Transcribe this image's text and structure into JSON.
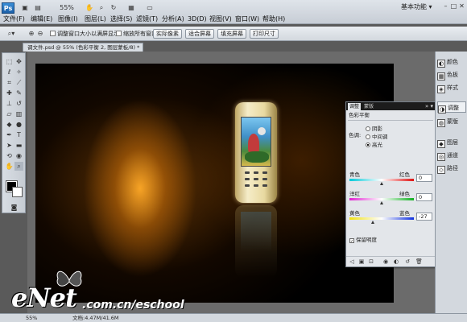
{
  "app": {
    "logo_text": "Ps",
    "zoom_display": "55%",
    "workspace": "基本功能",
    "window_controls": [
      "minimize-icon",
      "maximize-icon",
      "close-icon"
    ]
  },
  "menu": [
    "文件(F)",
    "编辑(E)",
    "图像(I)",
    "图层(L)",
    "选择(S)",
    "滤镜(T)",
    "分析(A)",
    "3D(D)",
    "视图(V)",
    "窗口(W)",
    "帮助(H)"
  ],
  "options_bar": {
    "resize_windows": "调整窗口大小以满屏显示",
    "zoom_all": "缩放所有窗口",
    "actual_pixels": "实际像素",
    "fit_screen": "适合屏幕",
    "fill_screen": "填充屏幕",
    "print_size": "打印尺寸"
  },
  "document_tab": "调文件.psd @ 55% (色彩平衡 2, 图层蒙板/8) *",
  "adjustments": {
    "tabs": [
      "调整",
      "蒙版"
    ],
    "title": "色彩平衡",
    "tone_label": "色调:",
    "tones": [
      "阴影",
      "中间调",
      "高光"
    ],
    "selected_tone": "高光",
    "sliders": [
      {
        "left": "青色",
        "right": "红色",
        "value": "0"
      },
      {
        "left": "洋红",
        "right": "绿色",
        "value": "0"
      },
      {
        "left": "黄色",
        "right": "蓝色",
        "value": "-27"
      }
    ],
    "preserve_luminosity": "保留明度"
  },
  "dock": [
    "颜色",
    "色板",
    "样式",
    "调整",
    "蒙版",
    "图层",
    "通道",
    "路径"
  ],
  "status": {
    "zoom": "55%",
    "doc": "文档:4.47M/41.6M"
  },
  "watermark": {
    "logo": "eNet",
    "url": ".com.cn/eschool"
  }
}
